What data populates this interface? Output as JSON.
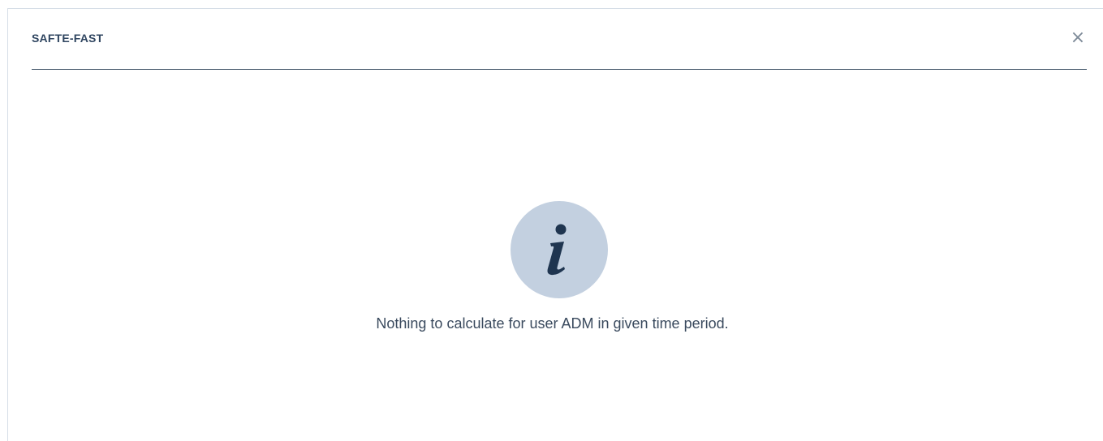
{
  "dialog": {
    "title": "SAFTE-FAST",
    "close_label": "×"
  },
  "info": {
    "icon": "info-icon",
    "icon_color": "#1f3550",
    "circle_color": "#c3d0e0",
    "message": "Nothing to calculate for user ADM in given time period."
  }
}
